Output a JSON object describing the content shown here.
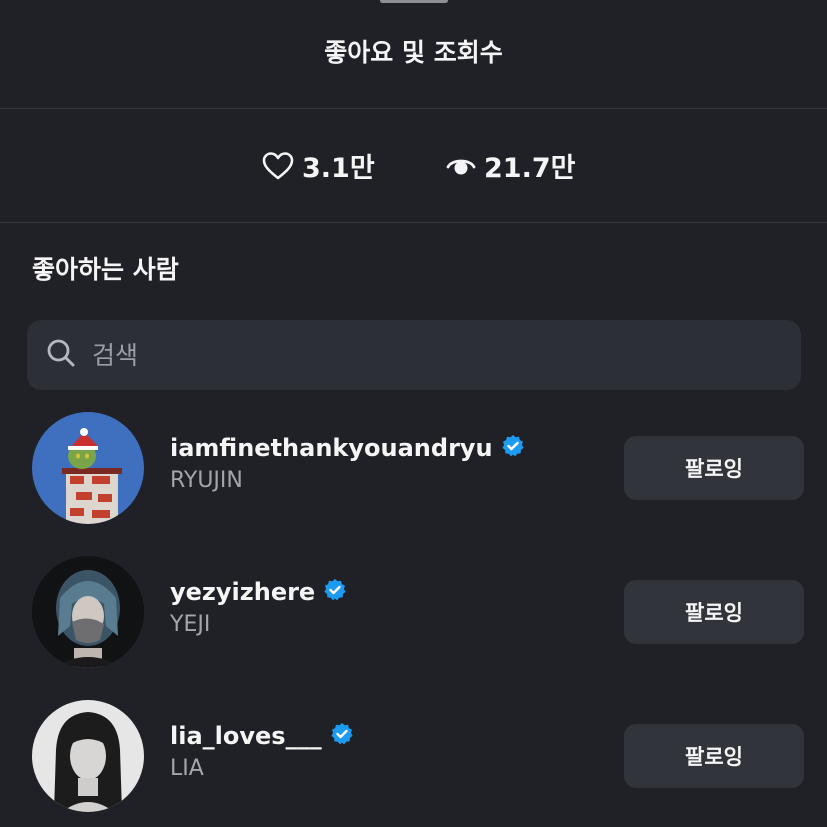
{
  "header": {
    "title": "좋아요 및 조회수"
  },
  "stats": {
    "likes": {
      "icon": "heart-icon",
      "value": "3.1만"
    },
    "views": {
      "icon": "eye-icon",
      "value": "21.7만"
    }
  },
  "section": {
    "title": "좋아하는 사람"
  },
  "search": {
    "icon": "search-icon",
    "placeholder": "검색"
  },
  "users": [
    {
      "username": "iamfinethankyouandryu",
      "display_name": "RYUJIN",
      "verified": true,
      "button_label": "팔로잉"
    },
    {
      "username": "yezyizhere",
      "display_name": "YEJI",
      "verified": true,
      "button_label": "팔로잉"
    },
    {
      "username": "lia_loves___",
      "display_name": "LIA",
      "verified": true,
      "button_label": "팔로잉"
    }
  ],
  "colors": {
    "background": "#1f2126",
    "surface": "#2c2f36",
    "button": "#31343b",
    "verified": "#1d9bf0",
    "secondary_text": "#a2a5ac"
  }
}
